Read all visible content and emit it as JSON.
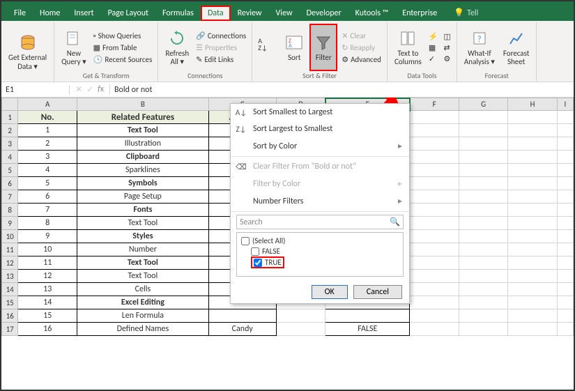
{
  "tabs": [
    "File",
    "Home",
    "Insert",
    "Page Layout",
    "Formulas",
    "Data",
    "Review",
    "View",
    "Developer",
    "Kutools ™",
    "Enterprise"
  ],
  "activeTab": "Data",
  "tellme": "Tell",
  "ribbon": {
    "getExternal": "Get External\nData ▾",
    "newQuery": "New\nQuery ▾",
    "showQueries": "Show Queries",
    "fromTable": "From Table",
    "recentSources": "Recent Sources",
    "groupGetTransform": "Get & Transform",
    "refreshAll": "Refresh\nAll ▾",
    "connections": "Connections",
    "properties": "Properties",
    "editLinks": "Edit Links",
    "groupConnections": "Connections",
    "sort": "Sort",
    "filter": "Filter",
    "clear": "Clear",
    "reapply": "Reapply",
    "advanced": "Advanced",
    "groupSortFilter": "Sort & Filter",
    "textToColumns": "Text to\nColumns",
    "groupDataTools": "Data Tools",
    "whatIf": "What-If\nAnalysis ▾",
    "forecast": "Forecast\nSheet",
    "groupForecast": "Forecast"
  },
  "namebox": "E1",
  "formula": "Bold or not",
  "columns": [
    "A",
    "B",
    "C",
    "D",
    "E",
    "F",
    "G",
    "H",
    "I"
  ],
  "headers": {
    "A": "No.",
    "B": "Related Features",
    "C": "Author",
    "E": "Bold or not"
  },
  "rows": [
    {
      "n": "1",
      "f": "Text Tool",
      "bold": true
    },
    {
      "n": "2",
      "f": "Illustration",
      "bold": false
    },
    {
      "n": "3",
      "f": "Clipboard",
      "bold": true
    },
    {
      "n": "4",
      "f": "Sparklines",
      "bold": false
    },
    {
      "n": "5",
      "f": "Symbols",
      "bold": true
    },
    {
      "n": "6",
      "f": "Page Setup",
      "bold": false
    },
    {
      "n": "7",
      "f": "Fonts",
      "bold": true
    },
    {
      "n": "8",
      "f": "Text Tool",
      "bold": false
    },
    {
      "n": "9",
      "f": "Styles",
      "bold": true
    },
    {
      "n": "10",
      "f": "Number",
      "bold": false
    },
    {
      "n": "11",
      "f": "Text Tool",
      "bold": true
    },
    {
      "n": "12",
      "f": "Text Tool",
      "bold": false
    },
    {
      "n": "13",
      "f": "Cells",
      "bold": false
    },
    {
      "n": "14",
      "f": "Excel Editing",
      "bold": true
    },
    {
      "n": "15",
      "f": "Len Formula",
      "bold": false
    },
    {
      "n": "16",
      "f": "Defined Names",
      "bold": false
    }
  ],
  "row17": {
    "author": "Candy",
    "e": "FALSE"
  },
  "dropdown": {
    "sortAsc": "Sort Smallest to Largest",
    "sortDesc": "Sort Largest to Smallest",
    "sortColor": "Sort by Color",
    "clearFilter": "Clear Filter From \"Bold or not\"",
    "filterColor": "Filter by Color",
    "numberFilters": "Number Filters",
    "search": "Search",
    "selectAll": "(Select All)",
    "optFalse": "FALSE",
    "optTrue": "TRUE",
    "ok": "OK",
    "cancel": "Cancel"
  }
}
